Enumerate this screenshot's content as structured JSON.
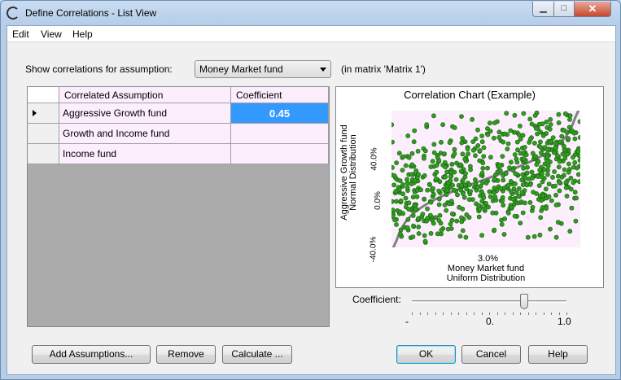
{
  "window": {
    "title": "Define Correlations - List View",
    "minimize": "▁",
    "maximize": "□",
    "close": "✕"
  },
  "menu": [
    "Edit",
    "View",
    "Help"
  ],
  "assumption": {
    "label": "Show correlations for assumption:",
    "selected": "Money Market fund",
    "matrix_note": "(in matrix 'Matrix 1')"
  },
  "table": {
    "headers": [
      "Correlated Assumption",
      "Coefficient"
    ],
    "rows": [
      {
        "name": "Aggressive Growth fund",
        "coefficient": "0.45"
      },
      {
        "name": "Growth and Income fund",
        "coefficient": ""
      },
      {
        "name": "Income fund",
        "coefficient": ""
      }
    ]
  },
  "chart": {
    "title": "Correlation Chart (Example)",
    "ylabel_line1": "Aggressive Growth fund",
    "ylabel_line2": "Normal Distribution",
    "yticks": [
      "40.0%",
      "0.0%",
      "-40.0%"
    ],
    "xtick": "3.0%",
    "xlabel_line1": "Money Market fund",
    "xlabel_line2": "Uniform Distribution",
    "point_color": "#2f9e1f",
    "line_color": "#808080"
  },
  "chart_data": {
    "type": "scatter",
    "title": "Correlation Chart (Example)",
    "xlabel": "Money Market fund Uniform Distribution",
    "ylabel": "Aggressive Growth fund Normal Distribution",
    "correlation": 0.45,
    "yticks": [
      "40.0%",
      "0.0%",
      "-40.0%"
    ],
    "xticks": [
      "3.0%"
    ]
  },
  "slider": {
    "label": "Coefficient:",
    "min_label": "-",
    "mid_label": "0.",
    "max_label": "1.0",
    "value": 0.45
  },
  "buttons": {
    "add": "Add Assumptions...",
    "remove": "Remove",
    "calculate": "Calculate ...",
    "ok": "OK",
    "cancel": "Cancel",
    "help": "Help"
  }
}
